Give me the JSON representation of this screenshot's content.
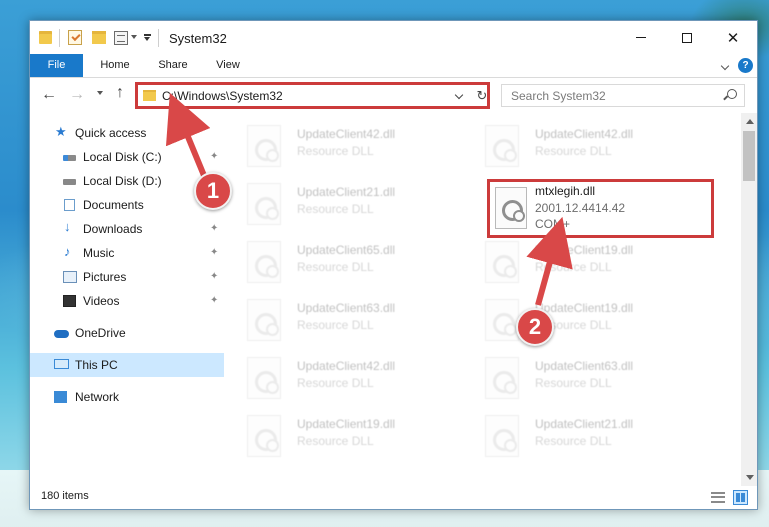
{
  "window": {
    "title": "System32",
    "minimize_label": "",
    "close_glyph": "✕"
  },
  "ribbon": {
    "tabs": [
      {
        "label": "File"
      },
      {
        "label": "Home"
      },
      {
        "label": "Share"
      },
      {
        "label": "View"
      }
    ],
    "help_glyph": "?"
  },
  "nav": {
    "back_glyph": "←",
    "forward_glyph": "→",
    "up_glyph": "↑",
    "refresh_glyph": "↻",
    "address": "C:\\Windows\\System32",
    "search_placeholder": "Search System32"
  },
  "sidebar": {
    "items": [
      {
        "label": "Quick access",
        "icon": "quick-access-star-icon",
        "pinned": false
      },
      {
        "label": "Local Disk (C:)",
        "icon": "drive-icon",
        "pinned": true
      },
      {
        "label": "Local Disk (D:)",
        "icon": "drive-icon",
        "pinned": false
      },
      {
        "label": "Documents",
        "icon": "documents-icon",
        "pinned": true
      },
      {
        "label": "Downloads",
        "icon": "downloads-icon",
        "pinned": true
      },
      {
        "label": "Music",
        "icon": "music-icon",
        "pinned": true
      },
      {
        "label": "Pictures",
        "icon": "pictures-icon",
        "pinned": true
      },
      {
        "label": "Videos",
        "icon": "videos-icon",
        "pinned": true
      },
      {
        "label": "OneDrive",
        "icon": "onedrive-icon",
        "pinned": false
      },
      {
        "label": "This PC",
        "icon": "this-pc-icon",
        "pinned": false,
        "selected": true
      },
      {
        "label": "Network",
        "icon": "network-icon",
        "pinned": false
      }
    ],
    "pin_glyph": "📌"
  },
  "files": [
    {
      "name": "UpdateClient42.dll",
      "desc": "Resource DLL"
    },
    {
      "name": "UpdateClient42.dll",
      "desc": "Resource DLL"
    },
    {
      "name": "UpdateClient21.dll",
      "desc": "Resource DLL"
    },
    {
      "name": "UpdateClient65.dll",
      "desc": "Resource DLL"
    },
    {
      "name": "UpdateClient19.dll",
      "desc": "Resource DLL"
    },
    {
      "name": "UpdateClient63.dll",
      "desc": "Resource DLL"
    },
    {
      "name": "UpdateClient19.dll",
      "desc": "Resource DLL"
    },
    {
      "name": "UpdateClient42.dll",
      "desc": "Resource DLL"
    },
    {
      "name": "UpdateClient63.dll",
      "desc": "Resource DLL"
    },
    {
      "name": "UpdateClient19.dll",
      "desc": "Resource DLL"
    },
    {
      "name": "UpdateClient21.dll",
      "desc": "Resource DLL"
    }
  ],
  "highlighted_file": {
    "name": "mtxlegih.dll",
    "version": "2001.12.4414.42",
    "desc": "COM+"
  },
  "status": {
    "item_count": "180 items"
  },
  "callouts": [
    {
      "number": "1"
    },
    {
      "number": "2"
    }
  ],
  "colors": {
    "accent": "#1979ca",
    "highlight_red": "#cc3b3b",
    "callout_red": "#d94848",
    "selection": "#cce8ff"
  }
}
